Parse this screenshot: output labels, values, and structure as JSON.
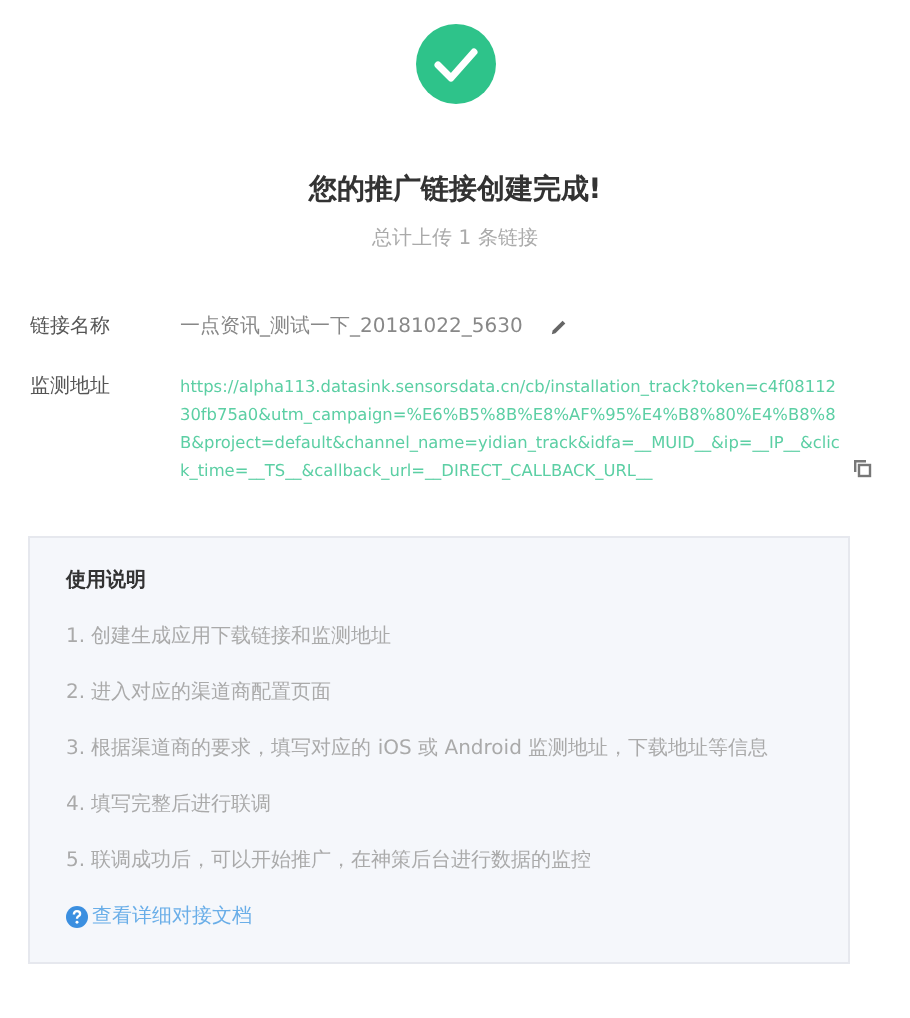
{
  "header": {
    "title": "您的推广链接创建完成!",
    "subtitle": "总计上传 1 条链接"
  },
  "fields": [
    {
      "kind": "name",
      "label": "链接名称",
      "value": "一点资讯_测试一下_20181022_5630"
    },
    {
      "kind": "url",
      "label": "监测地址",
      "value": "https://alpha113.datasink.sensorsdata.cn/cb/installation_track?token=c4f0811230fb75a0&utm_campaign=%E6%B5%8B%E8%AF%95%E4%B8%80%E4%B8%8B&project=default&channel_name=yidian_track&idfa=__MUID__&ip=__IP__&click_time=__TS__&callback_url=__DIRECT_CALLBACK_URL__"
    }
  ],
  "instructions": {
    "title": "使用说明",
    "steps": [
      "1. 创建生成应用下载链接和监测地址",
      "2. 进入对应的渠道商配置页面",
      "3. 根据渠道商的要求，填写对应的 iOS 或 Android 监测地址，下载地址等信息",
      "4. 填写完整后进行联调",
      "5. 联调成功后，可以开始推广，在神策后台进行数据的监控"
    ],
    "doc_link": "查看详细对接文档"
  }
}
